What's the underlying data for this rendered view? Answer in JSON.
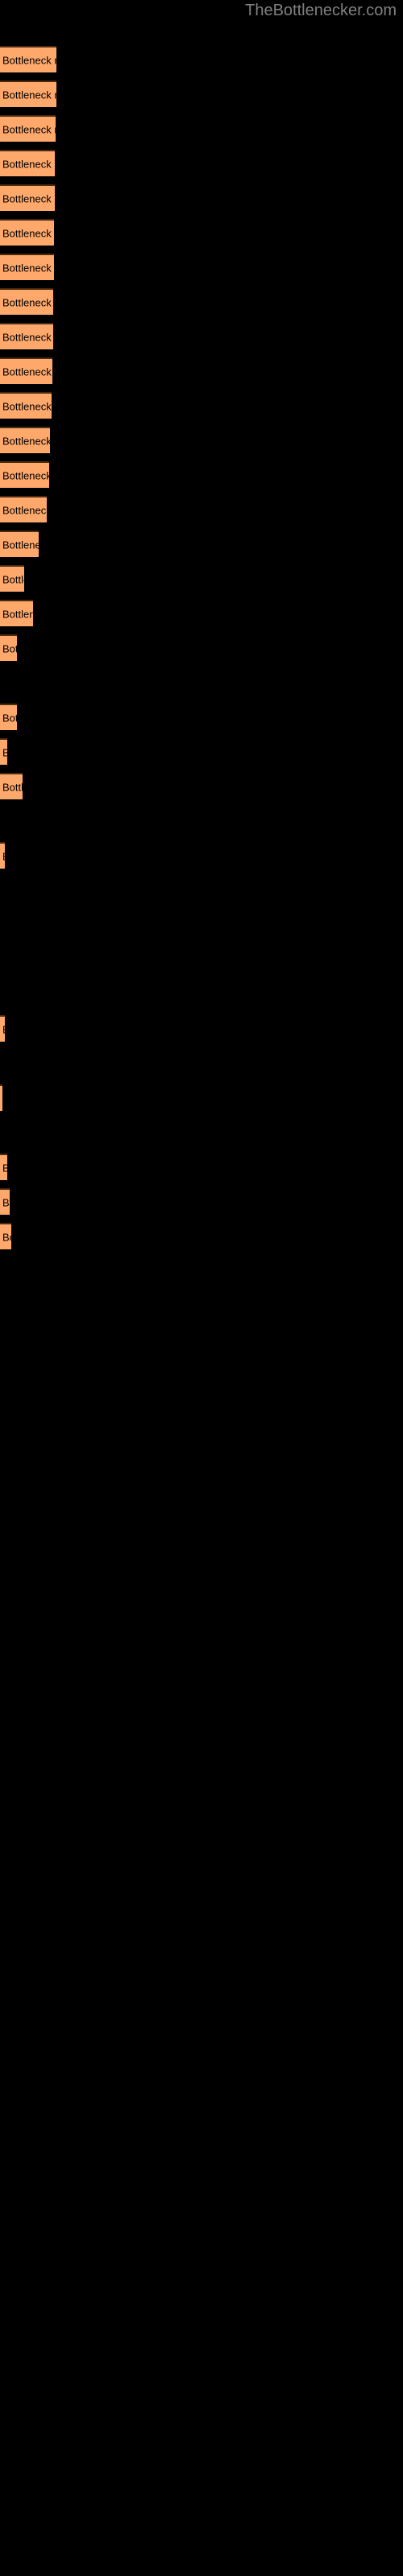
{
  "header": {
    "site_title": "TheBottlenecker.com"
  },
  "colors": {
    "background": "#000000",
    "bar_fill": "#FFA86B",
    "bar_border_top": "#4a2a10",
    "label_text": "#000000",
    "title_text": "#808080"
  },
  "chart_data": {
    "type": "bar",
    "orientation": "horizontal",
    "title": "TheBottlenecker.com",
    "xlabel": "",
    "ylabel": "",
    "grid": false,
    "legend": null,
    "bar_label_text": "Bottleneck result",
    "xlim": [
      0,
      500
    ],
    "categories": [
      "Bottleneck result",
      "Bottleneck result",
      "Bottleneck result",
      "Bottleneck result",
      "Bottleneck result",
      "Bottleneck result",
      "Bottleneck result",
      "Bottleneck result",
      "Bottleneck result",
      "Bottleneck result",
      "Bottleneck result",
      "Bottleneck result",
      "Bottleneck result",
      "Bottleneck result",
      "Bottleneck result",
      "Bottleneck result",
      "Bottleneck result",
      "Bottleneck result",
      "Bottleneck result",
      "Bottleneck result",
      "Bottleneck result",
      "Bottleneck result",
      "Bottleneck result",
      "Bottleneck result",
      "Bottleneck result",
      "Bottleneck result",
      "Bottleneck result",
      "Bottleneck result",
      "Bottleneck result",
      "Bottleneck result",
      "Bottleneck result",
      "Bottleneck result",
      "Bottleneck result",
      "Bottleneck result",
      "Bottleneck result"
    ],
    "values": [
      70,
      70,
      69,
      68,
      68,
      67,
      67,
      66,
      66,
      65,
      64,
      62,
      61,
      58,
      48,
      30,
      41,
      21,
      0,
      21,
      9,
      28,
      0,
      6,
      0,
      0,
      0,
      0,
      6,
      0,
      3,
      0,
      9,
      12,
      14
    ],
    "bar_tops": [
      57,
      100,
      143,
      186,
      229,
      272,
      315,
      358,
      401,
      444,
      487,
      530,
      573,
      616,
      659,
      702,
      745,
      788,
      831,
      874,
      917,
      960,
      1003,
      1046,
      1089,
      1132,
      1175,
      1218,
      1261,
      1304,
      1347,
      1390,
      1433,
      1476,
      1519
    ]
  },
  "bars": [
    {
      "label": "Bottleneck result",
      "width": 70,
      "top": 57
    },
    {
      "label": "Bottleneck result",
      "width": 70,
      "top": 100
    },
    {
      "label": "Bottleneck result",
      "width": 69,
      "top": 143
    },
    {
      "label": "Bottleneck result",
      "width": 68,
      "top": 186
    },
    {
      "label": "Bottleneck result",
      "width": 68,
      "top": 229
    },
    {
      "label": "Bottleneck result",
      "width": 67,
      "top": 272
    },
    {
      "label": "Bottleneck result",
      "width": 67,
      "top": 315
    },
    {
      "label": "Bottleneck result",
      "width": 66,
      "top": 358
    },
    {
      "label": "Bottleneck result",
      "width": 66,
      "top": 401
    },
    {
      "label": "Bottleneck result",
      "width": 65,
      "top": 444
    },
    {
      "label": "Bottleneck result",
      "width": 64,
      "top": 487
    },
    {
      "label": "Bottleneck result",
      "width": 62,
      "top": 530
    },
    {
      "label": "Bottleneck result",
      "width": 61,
      "top": 573
    },
    {
      "label": "Bottleneck result",
      "width": 58,
      "top": 616
    },
    {
      "label": "Bottleneck result",
      "width": 48,
      "top": 659
    },
    {
      "label": "Bottleneck result",
      "width": 30,
      "top": 702
    },
    {
      "label": "Bottleneck result",
      "width": 41,
      "top": 745
    },
    {
      "label": "Bottleneck result",
      "width": 21,
      "top": 788
    },
    {
      "label": "Bottleneck result",
      "width": 0,
      "top": 831
    },
    {
      "label": "Bottleneck result",
      "width": 21,
      "top": 874
    },
    {
      "label": "Bottleneck result",
      "width": 9,
      "top": 917
    },
    {
      "label": "Bottleneck result",
      "width": 28,
      "top": 960
    },
    {
      "label": "Bottleneck result",
      "width": 0,
      "top": 1003
    },
    {
      "label": "Bottleneck result",
      "width": 6,
      "top": 1046
    },
    {
      "label": "Bottleneck result",
      "width": 0,
      "top": 1089
    },
    {
      "label": "Bottleneck result",
      "width": 0,
      "top": 1132
    },
    {
      "label": "Bottleneck result",
      "width": 0,
      "top": 1175
    },
    {
      "label": "Bottleneck result",
      "width": 0,
      "top": 1218
    },
    {
      "label": "Bottleneck result",
      "width": 0,
      "top": 1261
    },
    {
      "label": "Bottleneck result",
      "width": 0,
      "top": 1304
    },
    {
      "label": "Bottleneck result",
      "width": 0,
      "top": 1347
    },
    {
      "label": "Bottleneck result",
      "width": 0,
      "top": 1390
    },
    {
      "label": "Bottleneck result",
      "width": 0,
      "top": 1433
    },
    {
      "label": "Bottleneck result",
      "width": 0,
      "top": 1476
    },
    {
      "label": "Bottleneck result",
      "width": 0,
      "top": 1519
    },
    {
      "label": "Bottleneck result",
      "width": 0,
      "top": 1562
    },
    {
      "label": "Bottleneck result",
      "width": 0,
      "top": 1605
    },
    {
      "label": "Bottleneck result",
      "width": 0,
      "top": 1648
    },
    {
      "label": "Bottleneck result",
      "width": 0,
      "top": 1691
    },
    {
      "label": "Bottleneck result",
      "width": 0,
      "top": 1734
    },
    {
      "label": "Bottleneck result",
      "width": 0,
      "top": 1777
    },
    {
      "label": "Bottleneck result",
      "width": 0,
      "top": 1820
    },
    {
      "label": "Bottleneck result",
      "width": 3,
      "top": 1863
    },
    {
      "label": "Bottleneck result",
      "width": 0,
      "top": 1906
    },
    {
      "label": "Bottleneck result",
      "width": 0,
      "top": 1949
    },
    {
      "label": "Bottleneck result",
      "width": 6,
      "top": 1992
    },
    {
      "label": "Bottleneck result",
      "width": 6,
      "top": 2035
    },
    {
      "label": "Bottleneck result",
      "width": 12,
      "top": 2078
    }
  ]
}
